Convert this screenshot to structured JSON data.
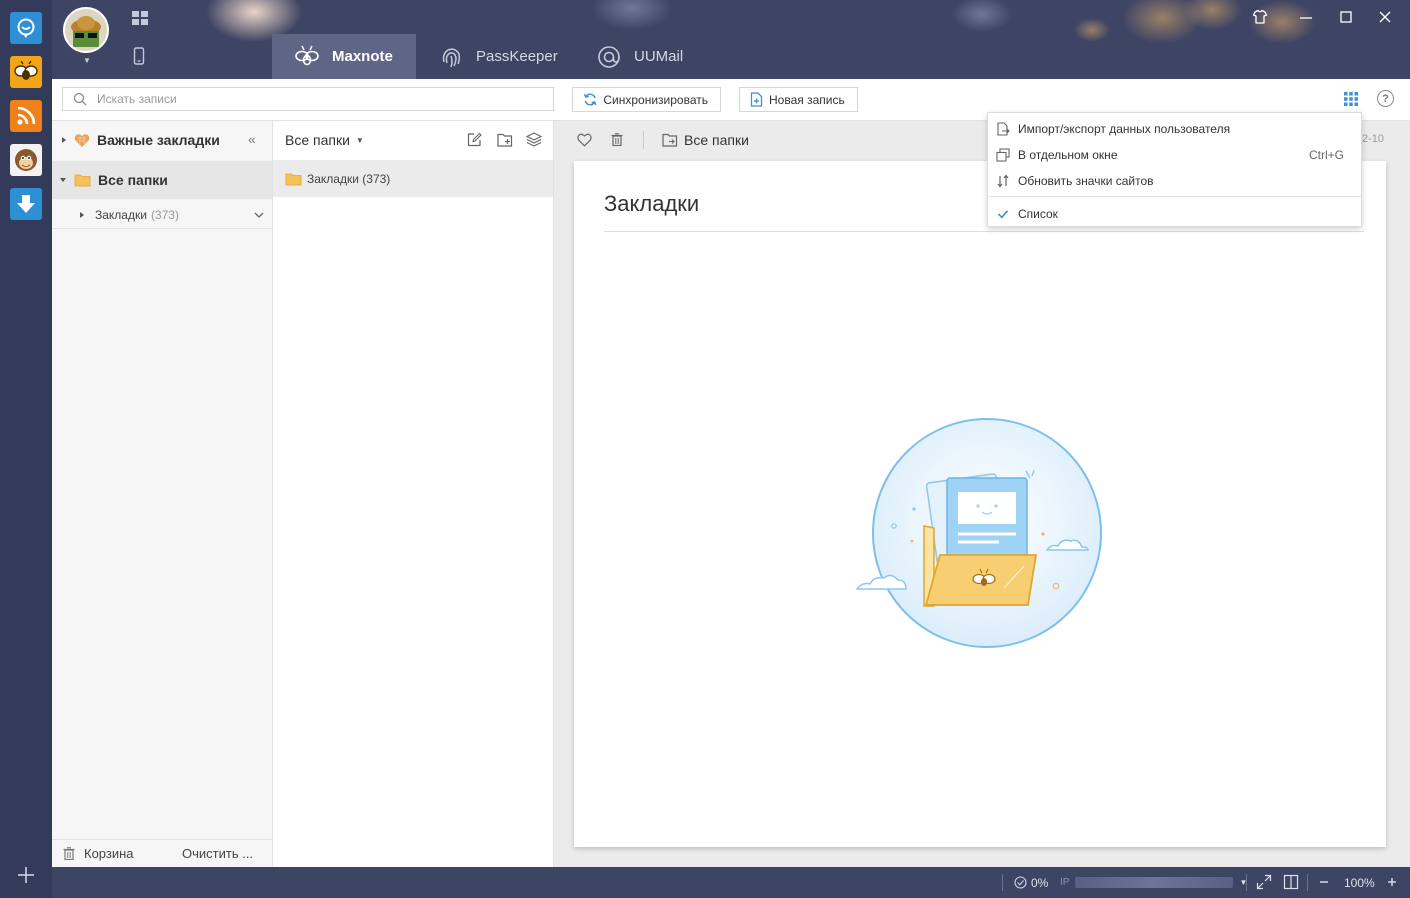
{
  "dock": {
    "items": [
      {
        "name": "message-app-icon",
        "color": "#2f8fd6"
      },
      {
        "name": "bee-app-icon",
        "color": "#f2a516"
      },
      {
        "name": "rss-app-icon",
        "color": "#f08019"
      },
      {
        "name": "monkey-app-icon",
        "color": "#f3f3f3"
      },
      {
        "name": "download-app-icon",
        "color": "#2d8fd4"
      }
    ]
  },
  "header": {
    "tabs": [
      {
        "label": "Maxnote",
        "active": true
      },
      {
        "label": "PassKeeper",
        "active": false
      },
      {
        "label": "UUMail",
        "active": false
      }
    ]
  },
  "toolbar": {
    "search_placeholder": "Искать записи",
    "sync_label": "Синхронизировать",
    "new_note_label": "Новая запись",
    "help_label": "?"
  },
  "sidebar": {
    "favorites_label": "Важные закладки",
    "all_folders_label": "Все папки",
    "bookmarks_label": "Закладки",
    "bookmarks_count": "(373)",
    "trash_label": "Корзина",
    "clear_label": "Очистить ..."
  },
  "folder_list": {
    "header_label": "Все папки",
    "items": [
      {
        "label": "Закладки (373)"
      }
    ]
  },
  "content": {
    "breadcrumb": "Все папки",
    "date_fragment": "2-10",
    "note_title": "Закладки"
  },
  "menu": {
    "items": [
      {
        "label": "Импорт/экспорт данных пользователя",
        "shortcut": "",
        "icon": "import-export-icon"
      },
      {
        "label": "В отдельном окне",
        "shortcut": "Ctrl+G",
        "icon": "window-icon"
      },
      {
        "label": "Обновить значки сайтов",
        "shortcut": "",
        "icon": "refresh-arrows-icon"
      },
      {
        "label": "Список",
        "shortcut": "",
        "icon": "checkmark-icon"
      }
    ]
  },
  "statusbar": {
    "cpu_label": "0%",
    "ip_label": "IP",
    "zoom_label": "100%"
  },
  "colors": {
    "accent": "#3d8fd6",
    "header_bg": "#3d4464",
    "dock_bg": "#343b5a",
    "folder_yellow": "#f5c15a"
  }
}
